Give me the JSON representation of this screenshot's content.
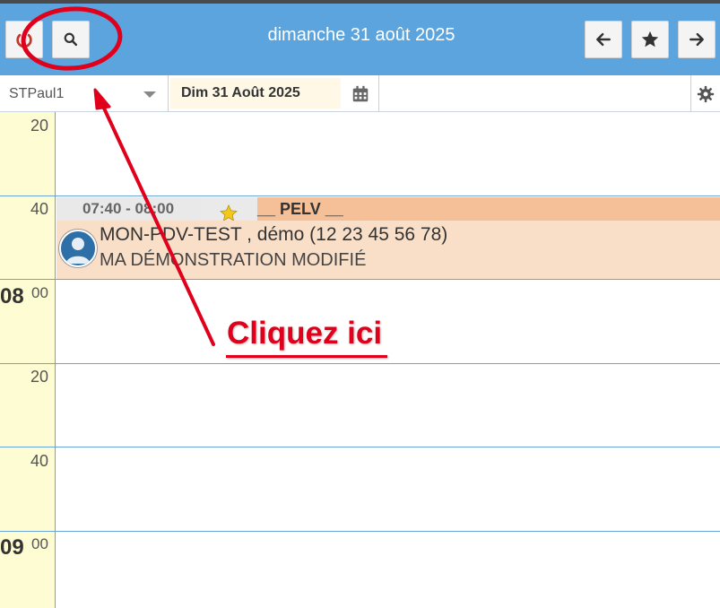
{
  "header": {
    "title": "dimanche 31 août 2025",
    "buttons": {
      "power": "power-icon",
      "search": "search-icon",
      "prev": "arrow-left-icon",
      "favorite": "star-icon",
      "next": "arrow-right-icon"
    }
  },
  "toolbar": {
    "agenda_select": "STPaul1",
    "date_field": "Dim 31 Août 2025"
  },
  "time_grid": {
    "labels": [
      {
        "minute": "20"
      },
      {
        "minute": "40"
      },
      {
        "hour": "08",
        "minute": "00"
      },
      {
        "minute": "20"
      },
      {
        "minute": "40"
      },
      {
        "hour": "09",
        "minute": "00"
      }
    ]
  },
  "appointment": {
    "time": "07:40 - 08:00",
    "type": "__ PELV __",
    "line1_name": "MON-PDV-TEST",
    "line1_rest": " , démo (12 23 45 56 78)",
    "line2": "MA DÉMONSTRATION MODIFIÉ"
  },
  "annotation": {
    "text": "Cliquez ici"
  },
  "colors": {
    "header_bg": "#5ba4dd",
    "time_col_bg": "#fefcd2",
    "appt_bg": "#f9dfc8",
    "appt_header_bg": "#f5bf97",
    "annotation_red": "#e0001b"
  }
}
